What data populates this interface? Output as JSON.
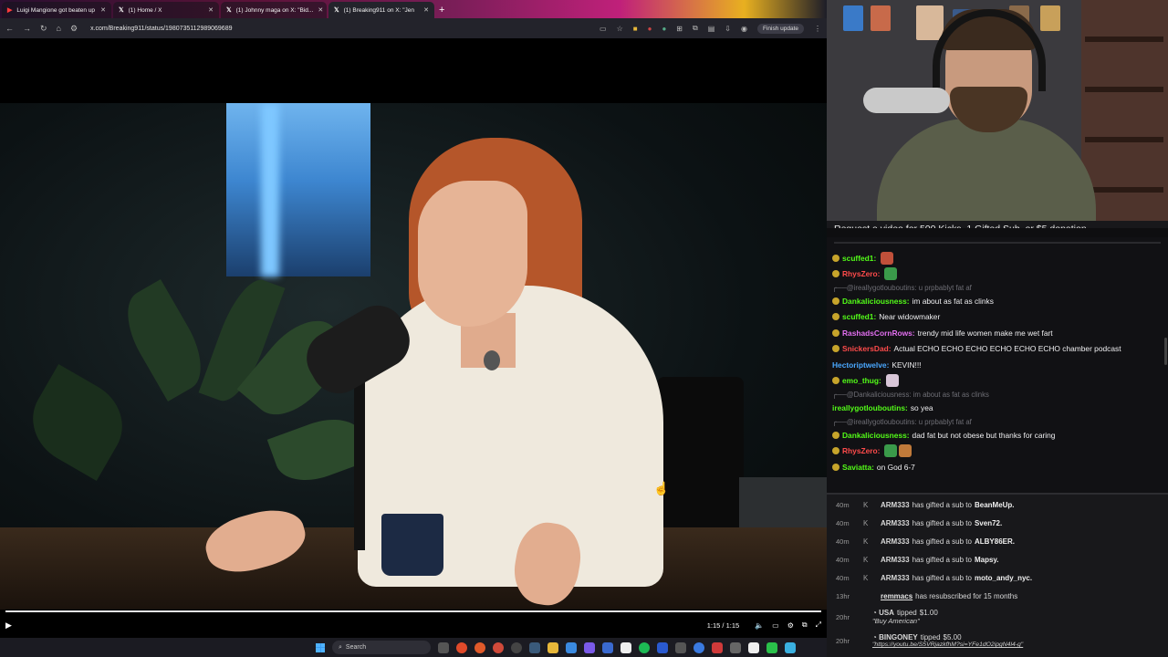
{
  "browser": {
    "tabs": [
      {
        "label": "Luigi Mangione got beaten up",
        "active": false
      },
      {
        "label": "(1) Home / X",
        "active": false
      },
      {
        "label": "(1) Johnny maga on X: \"Bid...",
        "active": false
      },
      {
        "label": "(1) Breaking911 on X: \"Jen",
        "active": true
      }
    ],
    "url": "x.com/Breaking911/status/1980735112989069689",
    "finish_update": "Finish update"
  },
  "video": {
    "time": "1:15 / 1:15",
    "progress": 1.0
  },
  "taskbar": {
    "search": "Search"
  },
  "stream": {
    "banner": "Request a video for 500 Kicks, 1 Gifted Sub, or $5 donation."
  },
  "chat": {
    "messages": [
      {
        "type": "msg",
        "user": "scuffed1:",
        "color": "#53fc18",
        "text": "",
        "emotes": [
          "#c0503a"
        ]
      },
      {
        "type": "msg",
        "user": "RhysZero:",
        "color": "#ff4b4b",
        "text": "",
        "emotes": [
          "#3a9a4a"
        ]
      },
      {
        "type": "reply",
        "text": "@ireallygotlouboutins: u prpbablyt fat af"
      },
      {
        "type": "msg",
        "user": "Dankaliciousness:",
        "color": "#53fc18",
        "text": "im about as fat as clinks",
        "emotes": []
      },
      {
        "type": "msg",
        "user": "scuffed1:",
        "color": "#53fc18",
        "text": "Near widowmaker",
        "emotes": []
      },
      {
        "type": "msg",
        "user": "RashadsCornRows:",
        "color": "#e26ff0",
        "text": "trendy mid life women make me wet fart",
        "emotes": []
      },
      {
        "type": "msg",
        "user": "SnickersDad:",
        "color": "#ff4b4b",
        "text": "Actual ECHO ECHO ECHO ECHO ECHO ECHO chamber podcast",
        "emotes": []
      },
      {
        "type": "msg",
        "user": "Hectoriptwelve:",
        "color": "#4aa8ff",
        "text": "KEVIN!!!",
        "emotes": [],
        "nobadge": true
      },
      {
        "type": "msg",
        "user": "emo_thug:",
        "color": "#53fc18",
        "text": "",
        "emotes": [
          "#d8c6d8"
        ]
      },
      {
        "type": "reply",
        "text": "@Dankaliciousness: im about as fat as clinks"
      },
      {
        "type": "msg",
        "user": "ireallygotlouboutins:",
        "color": "#53fc18",
        "text": "so yea",
        "emotes": [],
        "nobadge": true
      },
      {
        "type": "reply",
        "text": "@ireallygotlouboutins: u prpbablyt fat af"
      },
      {
        "type": "msg",
        "user": "Dankaliciousness:",
        "color": "#53fc18",
        "text": "dad fat but not obese but thanks for caring",
        "emotes": []
      },
      {
        "type": "msg",
        "user": "RhysZero:",
        "color": "#ff4b4b",
        "text": "",
        "emotes": [
          "#3a9a4a",
          "#c07a3a"
        ]
      },
      {
        "type": "msg",
        "user": "Saviatta:",
        "color": "#53fc18",
        "text": "on God 6-7",
        "emotes": []
      }
    ]
  },
  "events": [
    {
      "age": "40m",
      "actor": "ARM333",
      "action": "has gifted a sub to",
      "target": "BeanMeUp."
    },
    {
      "age": "40m",
      "actor": "ARM333",
      "action": "has gifted a sub to",
      "target": "Sven72."
    },
    {
      "age": "40m",
      "actor": "ARM333",
      "action": "has gifted a sub to",
      "target": "ALBY86ER."
    },
    {
      "age": "40m",
      "actor": "ARM333",
      "action": "has gifted a sub to",
      "target": "Mapsy."
    },
    {
      "age": "40m",
      "actor": "ARM333",
      "action": "has gifted a sub to",
      "target": "moto_andy_nyc."
    },
    {
      "age": "13hr",
      "actor": "remmacs",
      "action": "has resubscribed for 15 months",
      "target": ""
    }
  ],
  "tips": [
    {
      "age": "20hr",
      "actor": "USA",
      "action": "tipped",
      "amount": "$1.00",
      "message": "\"Buy American\""
    },
    {
      "age": "20hr",
      "actor": "BINGONEY",
      "action": "tipped",
      "amount": "$5.00",
      "message": "\"https://youtu.be/S5VRjazkfhM?si=YFe1dO2ipgN4l4-g\""
    }
  ]
}
